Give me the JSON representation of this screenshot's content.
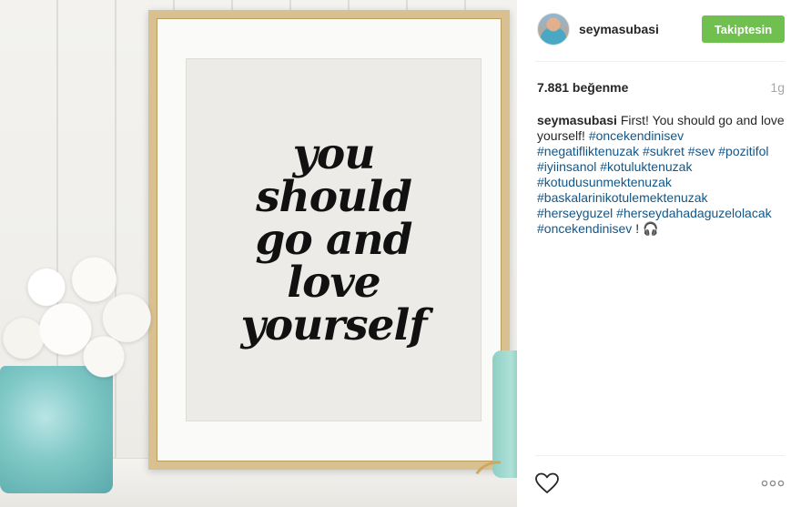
{
  "photo": {
    "quote_lines": [
      "you",
      "should",
      "go and",
      "love",
      "yourself"
    ]
  },
  "header": {
    "username": "seymasubasi",
    "follow_label": "Takiptesin",
    "follow_color": "#70c050"
  },
  "stats": {
    "likes": "7.881 beğenme",
    "time": "1g"
  },
  "caption": {
    "username": "seymasubasi",
    "text": "First! You should go and love yourself!",
    "hashtags": [
      "#oncekendinisev",
      "#negatifliktenuzak",
      "#sukret",
      "#sev",
      "#pozitifol",
      "#iyiinsanol",
      "#kotuluktenuzak",
      "#kotudusunmektenuzak",
      "#baskalarinikotulemektenuzak",
      "#herseyguzel",
      "#herseydahadaguzelolacak",
      "#oncekendinisev"
    ],
    "trailing": "! 🎧"
  },
  "icons": {
    "like": "heart-icon",
    "more": "more-options-icon"
  },
  "colors": {
    "hashtag": "#125688",
    "muted": "#a5a7aa"
  }
}
